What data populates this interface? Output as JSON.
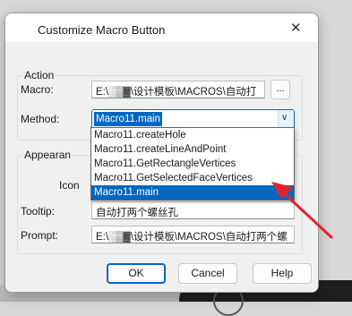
{
  "dialog": {
    "title": "Customize Macro Button",
    "close_glyph": "✕"
  },
  "action": {
    "group_label": "Action",
    "macro_label": "Macro:",
    "macro_value": "E:\\░▒▓\\设计模板\\MACROS\\自动打",
    "browse_label": "...",
    "method_label": "Method:",
    "method_selected": "Macro11.main",
    "method_options": [
      "Macro11.createHole",
      "Macro11.createLineAndPoint",
      "Macro11.GetRectangleVertices",
      "Macro11.GetSelectedFaceVertices",
      "Macro11.main"
    ],
    "dropdown_arrow": "∨"
  },
  "appearance": {
    "group_label": "Appearan",
    "icon_label": "Icon",
    "tooltip_label": "Tooltip:",
    "tooltip_value": "自动打两个螺丝孔",
    "prompt_label": "Prompt:",
    "prompt_value": "E:\\░▒▓\\设计模板\\MACROS\\自动打两个螺"
  },
  "buttons": {
    "ok": "OK",
    "cancel": "Cancel",
    "help": "Help"
  },
  "colors": {
    "accent": "#0067c0",
    "annotation_arrow": "#e0242d"
  }
}
